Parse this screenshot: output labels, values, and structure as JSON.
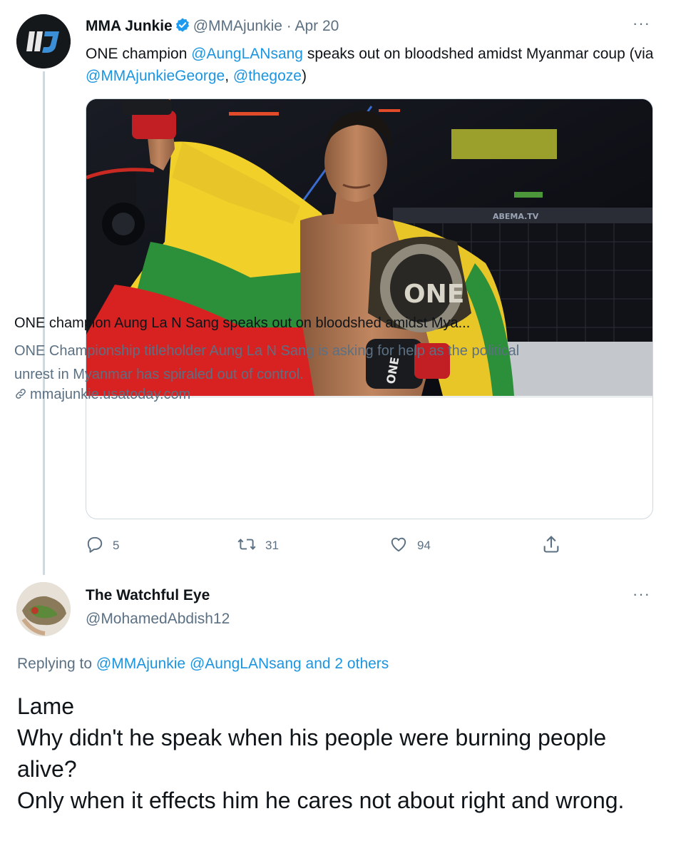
{
  "tweet": {
    "author_name": "MMA Junkie",
    "handle": "@MMAjunkie",
    "separator": "·",
    "date": "Apr 20",
    "more": "···",
    "text_1": "ONE champion ",
    "mention_1": "@AungLANsang",
    "text_2": " speaks out on bloodshed amidst Myanmar coup (via ",
    "mention_2": "@MMAjunkieGeorge",
    "text_3": ", ",
    "mention_3": "@thegoze",
    "text_4": ")",
    "card": {
      "title": "ONE champion Aung La N Sang speaks out on bloodshed amidst Mya...",
      "description": "ONE Championship titleholder Aung La N Sang is asking for help as the political unrest in Myanmar has spiraled out of control.",
      "domain": "mmajunkie.usatoday.com",
      "image_text": {
        "screen_label": "ABEMA.TV",
        "belt_text": "ONE",
        "glove_text": "ONE"
      }
    },
    "actions": {
      "replies": "5",
      "retweets": "31",
      "likes": "94"
    }
  },
  "reply": {
    "author_name": "The Watchful Eye",
    "handle": "@MohamedAbdish12",
    "more": "···",
    "replying_prefix": "Replying to ",
    "replying_mention_1": "@MMAjunkie",
    "replying_mention_2": "@AungLANsang",
    "replying_others": "and 2 others",
    "lines": [
      "Lame",
      "Why didn't he speak when his people were burning people alive?",
      "Only when it effects him he cares not about right and wrong."
    ]
  },
  "colors": {
    "link": "#1b95e0",
    "secondary_text": "#5b7083",
    "border": "#cfd9de",
    "verified": "#1d9bf0"
  },
  "icons": [
    "reply-icon",
    "retweet-icon",
    "like-icon",
    "share-icon",
    "verified-badge-icon",
    "link-icon",
    "more-icon"
  ]
}
